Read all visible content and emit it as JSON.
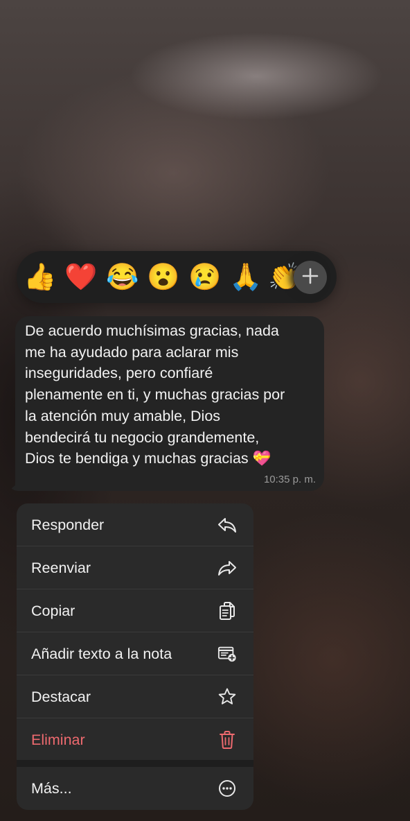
{
  "reactions": {
    "emojis": [
      "👍",
      "❤️",
      "😂",
      "😮",
      "😢",
      "🙏",
      "👏"
    ],
    "more_icon": "plus-icon"
  },
  "message": {
    "text": "De acuerdo muchísimas gracias, nada\nme ha ayudado para aclarar mis\ninseguridades, pero confiaré\nplenamente en ti, y muchas gracias por\nla atención muy amable, Dios\nbendecirá tu negocio grandemente,\nDios te bendiga y muchas gracias 💝",
    "time": "10:35 p. m."
  },
  "menu": {
    "reply": "Responder",
    "forward": "Reenviar",
    "copy": "Copiar",
    "add_to_note": "Añadir texto a la nota",
    "star": "Destacar",
    "delete": "Eliminar",
    "more": "Más..."
  },
  "colors": {
    "danger": "#ee6a6f",
    "menu_bg": "#2a2a2a",
    "bubble_bg": "#242424"
  }
}
